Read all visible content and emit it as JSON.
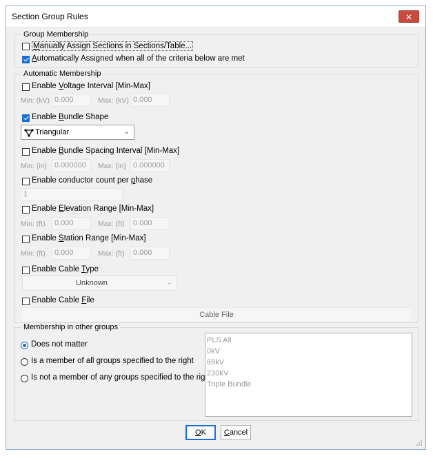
{
  "window": {
    "title": "Section Group Rules",
    "close_glyph": "✕"
  },
  "group_membership": {
    "legend": "Group Membership",
    "manual": {
      "pre": "",
      "ul": "M",
      "post": "anually Assign Sections in Sections/Table...",
      "checked": false
    },
    "auto": {
      "pre": "",
      "ul": "A",
      "post": "utomatically Assigned when all of the criteria below are met",
      "checked": true
    }
  },
  "automatic": {
    "legend": "Automatic Membership",
    "voltage": {
      "pre": "Enable ",
      "ul": "V",
      "post": "oltage Interval [Min-Max]",
      "checked": false,
      "min_label": "Min: (kV)",
      "min_value": "0.000",
      "max_label": "Max: (kV)",
      "max_value": "0.000"
    },
    "bundle_shape": {
      "pre": "Enable ",
      "ul": "B",
      "post": "undle Shape",
      "checked": true,
      "selected": "Triangular"
    },
    "bundle_spacing": {
      "pre": "Enable ",
      "ul": "B",
      "post": "undle Spacing Interval [Min-Max]",
      "checked": false,
      "min_label": "Min: (in)",
      "min_value": "0.000000",
      "max_label": "Max: (in)",
      "max_value": "0.000000"
    },
    "conductor_count": {
      "pre": "Enable conductor count per ",
      "ul": "p",
      "post": "hase",
      "checked": false,
      "value": "1"
    },
    "elevation": {
      "pre": "Enable ",
      "ul": "E",
      "post": "levation Range [Min-Max]",
      "checked": false,
      "min_label": "Min: (ft)",
      "min_value": "0.000",
      "max_label": "Max: (ft)",
      "max_value": "0.000"
    },
    "station": {
      "pre": "Enable ",
      "ul": "S",
      "post": "tation Range [Min-Max]",
      "checked": false,
      "min_label": "Min: (ft)",
      "min_value": "0.000",
      "max_label": "Max: (ft)",
      "max_value": "0.000"
    },
    "cable_type": {
      "pre": "Enable Cable ",
      "ul": "T",
      "post": "ype",
      "checked": false,
      "selected": "Unknown"
    },
    "cable_file": {
      "pre": "Enable Cable ",
      "ul": "F",
      "post": "ile",
      "checked": false,
      "button": "Cable File"
    }
  },
  "other_groups": {
    "legend": "Membership in other groups",
    "options": [
      {
        "label": "Does not matter",
        "checked": true
      },
      {
        "label": "Is a member of all groups specified to the right",
        "checked": false
      },
      {
        "label": "Is not a member of any groups specified to the right",
        "checked": false
      }
    ],
    "groups": [
      "PLS All",
      "0kV",
      "69kV",
      "230kV",
      "Triple Bundle"
    ]
  },
  "buttons": {
    "ok": {
      "ul": "O",
      "post": "K"
    },
    "cancel": {
      "ul": "C",
      "post": "ancel"
    }
  },
  "colors": {
    "accent": "#1a6fd6",
    "close": "#c94a3e"
  }
}
